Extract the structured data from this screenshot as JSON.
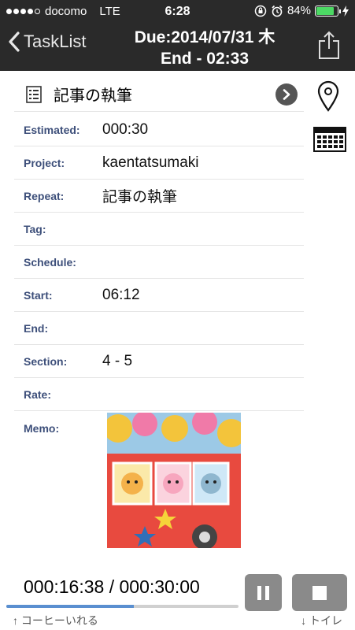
{
  "status_bar": {
    "carrier": "docomo",
    "network": "LTE",
    "time": "6:28",
    "battery_percent": "84%",
    "battery_level": 0.84,
    "signal_bars_filled": 4,
    "signal_bars_total": 5
  },
  "nav": {
    "back_label": "TaskList",
    "title_line1": "Due:2014/07/31 木",
    "title_line2": "End - 02:33"
  },
  "task": {
    "name": "記事の執筆"
  },
  "fields": {
    "estimated": {
      "label": "Estimated:",
      "value": "000:30"
    },
    "project": {
      "label": "Project:",
      "value": "kaentatsumaki"
    },
    "repeat": {
      "label": "Repeat:",
      "value": "記事の執筆"
    },
    "tag": {
      "label": "Tag:",
      "value": ""
    },
    "schedule": {
      "label": "Schedule:",
      "value": ""
    },
    "start": {
      "label": "Start:",
      "value": "06:12"
    },
    "end": {
      "label": "End:",
      "value": ""
    },
    "section": {
      "label": "Section:",
      "value": "4 - 5"
    },
    "rate": {
      "label": "Rate:",
      "value": ""
    },
    "memo": {
      "label": "Memo:"
    }
  },
  "timer": {
    "text": "000:16:38 / 000:30:00",
    "progress_fraction": 0.55
  },
  "footer": {
    "prev_task": "↑ コーヒーいれる",
    "next_task": "↓ トイレ"
  },
  "colors": {
    "header_bg": "#2a2a2a",
    "label_color": "#3d4f7a",
    "battery_green": "#4cd964",
    "progress_blue": "#5a8fd0",
    "button_gray": "#8a8a8a"
  },
  "icons": {
    "back": "chevron-left-icon",
    "share": "share-icon",
    "task": "list-icon",
    "disclosure": "chevron-right-icon",
    "location": "map-pin-icon",
    "calendar": "calendar-icon",
    "pause": "pause-icon",
    "stop": "stop-icon"
  }
}
